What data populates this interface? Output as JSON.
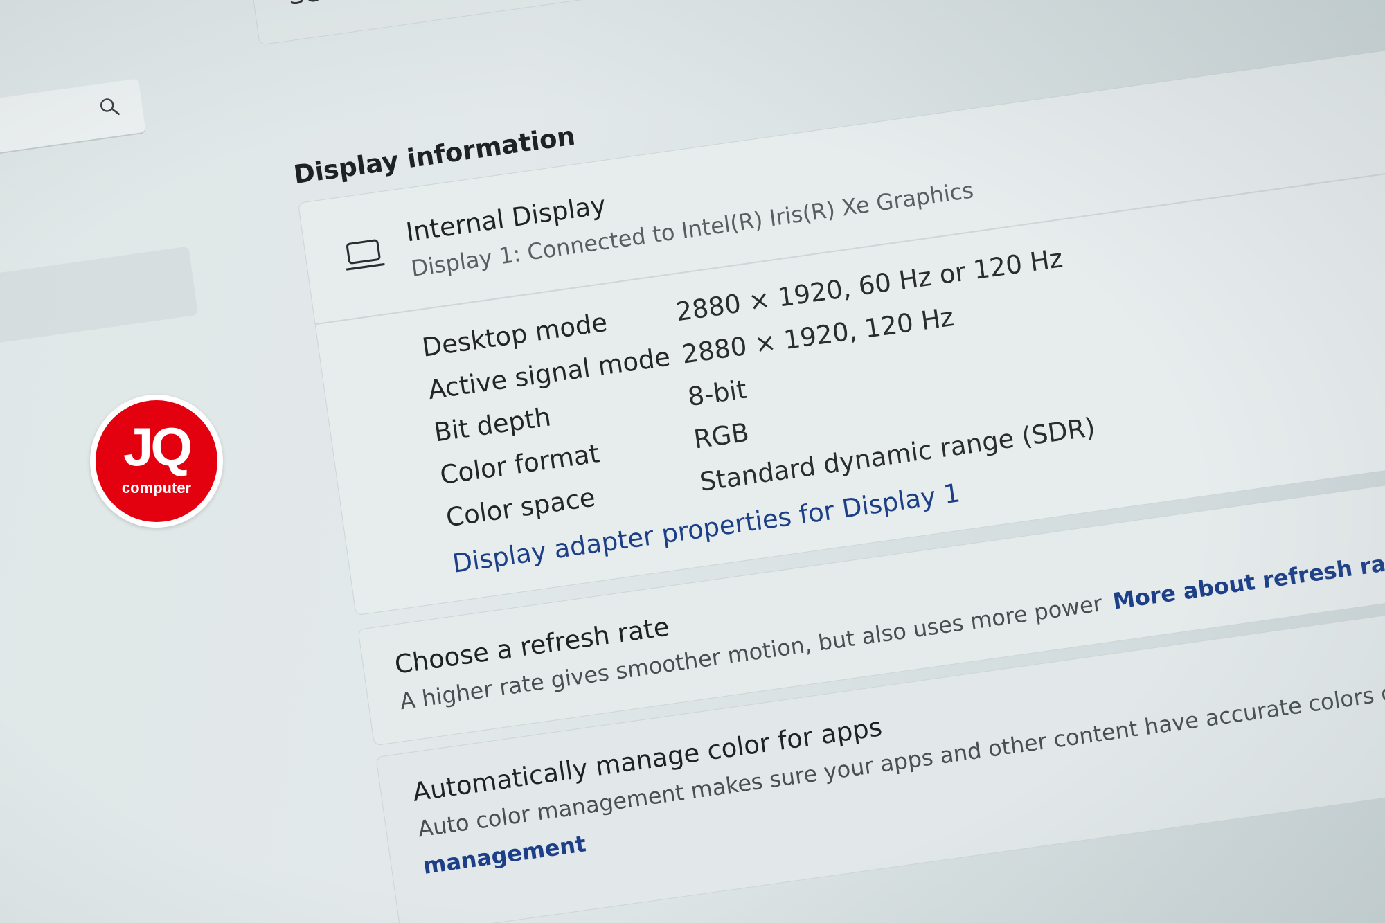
{
  "top_card": {
    "select_prompt": "Select a display to view or change its settings"
  },
  "search": {
    "icon": "search-icon"
  },
  "display_information": {
    "section_title": "Display information",
    "display_name": "Internal Display",
    "display_subtitle": "Display 1: Connected to Intel(R) Iris(R) Xe Graphics",
    "icon": "laptop-icon",
    "properties": [
      {
        "label": "Desktop mode",
        "value": "2880 × 1920, 60 Hz or 120 Hz"
      },
      {
        "label": "Active signal mode",
        "value": "2880 × 1920, 120 Hz"
      },
      {
        "label": "Bit depth",
        "value": "8-bit"
      },
      {
        "label": "Color format",
        "value": "RGB"
      },
      {
        "label": "Color space",
        "value": "Standard dynamic range (SDR)"
      }
    ],
    "adapter_link": "Display adapter properties for Display 1"
  },
  "refresh_rate": {
    "title": "Choose a refresh rate",
    "description": "A higher rate gives smoother motion, but also uses more power",
    "link": "More about refresh rate"
  },
  "color_management": {
    "title": "Automatically manage color for apps",
    "description": "Auto color management makes sure your apps and other content have accurate colors on this display (th",
    "link": "management"
  },
  "watermark": {
    "logo_text": "JQ",
    "logo_subtext": "computer"
  },
  "colors": {
    "link": "#1c3f88",
    "logo_red": "#e3000f"
  }
}
